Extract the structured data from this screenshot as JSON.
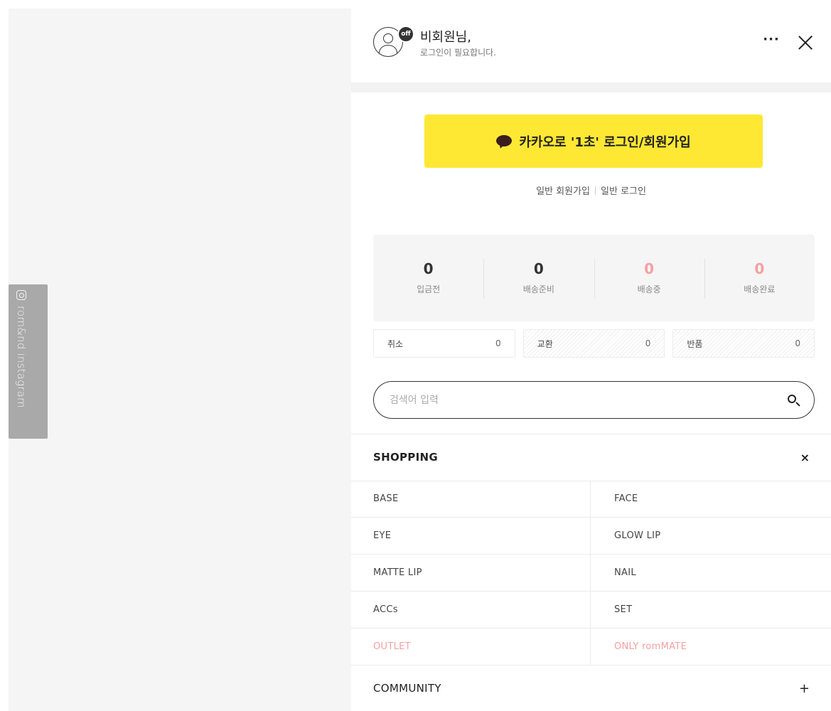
{
  "sidebar_tab": {
    "label": "rom&nd instagram",
    "icon": "instagram-icon"
  },
  "header": {
    "greeting": "비회원님,",
    "subtext": "로그인이 필요합니다.",
    "badge": "off",
    "more_label": "···"
  },
  "kakao": {
    "label": "카카오로 '1초' 로그인/회원가입",
    "icon": "kakao-chat-icon",
    "color": "#fee834"
  },
  "auth_links": {
    "signup": "일반 회원가입",
    "login": "일반 로그인"
  },
  "order_status": [
    {
      "count": "0",
      "label": "입금전",
      "highlight": false
    },
    {
      "count": "0",
      "label": "배송준비",
      "highlight": false
    },
    {
      "count": "0",
      "label": "배송중",
      "highlight": true
    },
    {
      "count": "0",
      "label": "배송완료",
      "highlight": true
    }
  ],
  "claims": [
    {
      "label": "취소",
      "count": "0"
    },
    {
      "label": "교환",
      "count": "0"
    },
    {
      "label": "반품",
      "count": "0"
    }
  ],
  "search": {
    "placeholder": "검색어 입력"
  },
  "shopping": {
    "title": "SHOPPING",
    "toggle": "×",
    "items": [
      {
        "label": "BASE",
        "highlight": false
      },
      {
        "label": "FACE",
        "highlight": false
      },
      {
        "label": "EYE",
        "highlight": false
      },
      {
        "label": "GLOW LIP",
        "highlight": false
      },
      {
        "label": "MATTE LIP",
        "highlight": false
      },
      {
        "label": "NAIL",
        "highlight": false
      },
      {
        "label": "ACCs",
        "highlight": false
      },
      {
        "label": "SET",
        "highlight": false
      },
      {
        "label": "OUTLET",
        "highlight": true
      },
      {
        "label": "ONLY romMATE",
        "highlight": true
      }
    ]
  },
  "community": {
    "title": "COMMUNITY",
    "toggle": "+"
  },
  "colors": {
    "accent_pink": "#f59fa3",
    "kakao_yellow": "#fee834",
    "tab_gray": "#a9a9a9"
  }
}
